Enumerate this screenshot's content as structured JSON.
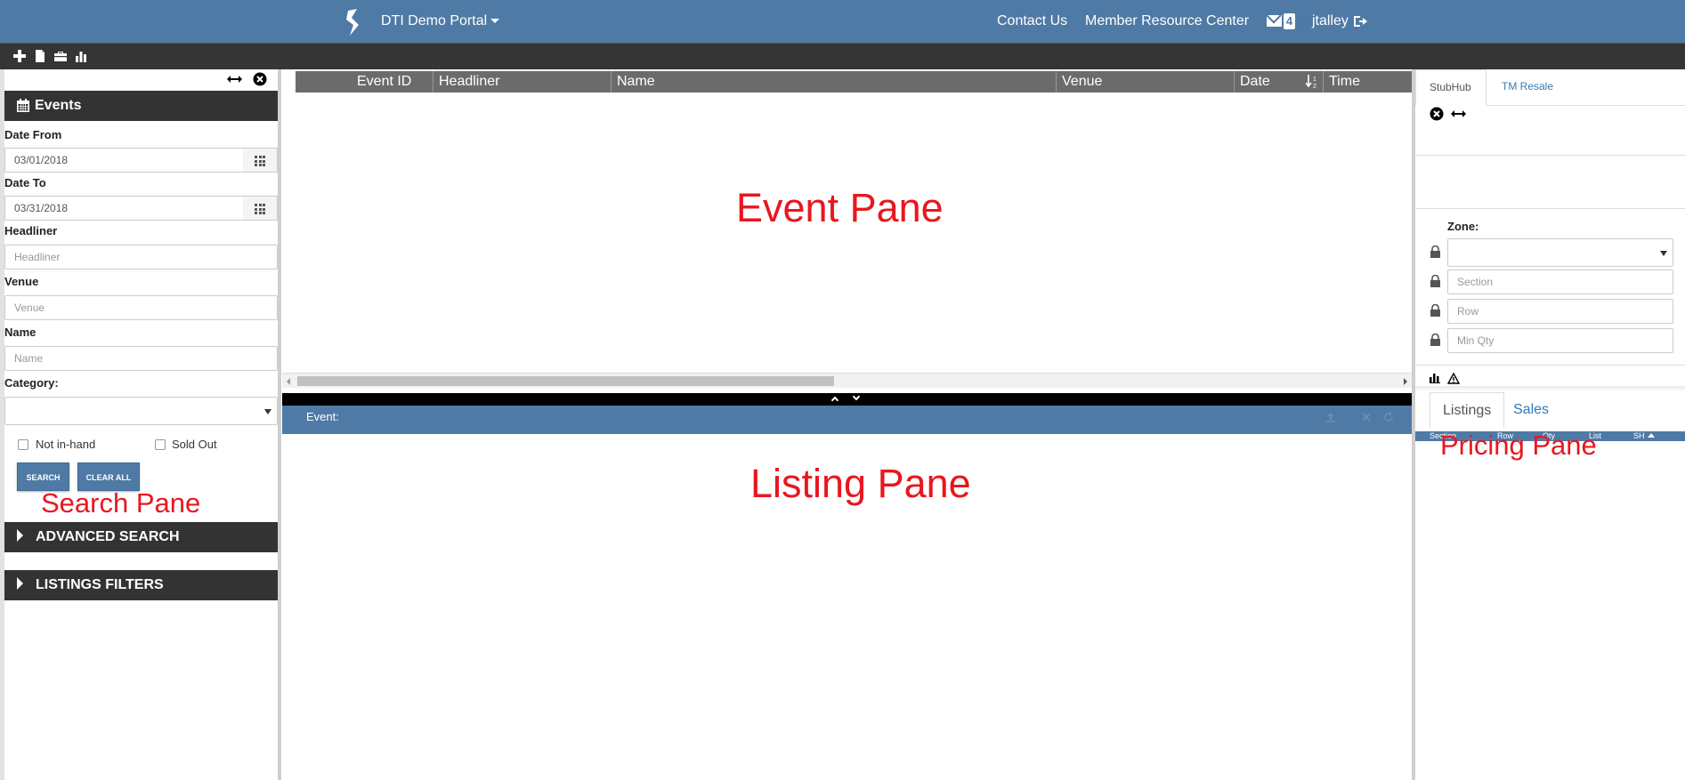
{
  "nav": {
    "brand": "DTI Demo Portal",
    "contact": "Contact Us",
    "member_center": "Member Resource Center",
    "mail_count": "4",
    "user": "jtalley",
    "bg_color": "#4f7aa5"
  },
  "toolbar": {
    "icons": [
      "plus-icon",
      "file-icon",
      "briefcase-icon",
      "bar-chart-icon"
    ]
  },
  "search_pane": {
    "section_title": "Events",
    "date_from_label": "Date From",
    "date_from_value": "03/01/2018",
    "date_to_label": "Date To",
    "date_to_value": "03/31/2018",
    "headliner_label": "Headliner",
    "headliner_placeholder": "Headliner",
    "venue_label": "Venue",
    "venue_placeholder": "Venue",
    "name_label": "Name",
    "name_placeholder": "Name",
    "category_label": "Category:",
    "category_value": "",
    "not_in_hand": "Not in-hand",
    "sold_out": "Sold Out",
    "search_btn": "SEARCH",
    "clear_btn": "CLEAR ALL",
    "advanced": "ADVANCED SEARCH",
    "listings_filters": "LISTINGS FILTERS"
  },
  "event_pane": {
    "columns": [
      "Event ID",
      "Headliner",
      "Name",
      "Venue",
      "Date",
      "Time"
    ]
  },
  "listing_pane": {
    "event_label": "Event:"
  },
  "pricing_pane": {
    "tabs": [
      "StubHub",
      "TM Resale"
    ],
    "zone_label": "Zone:",
    "zone_value": "",
    "section_placeholder": "Section",
    "row_placeholder": "Row",
    "min_qty_placeholder": "Min Qty",
    "bottom_tabs": [
      "Listings",
      "Sales"
    ],
    "mini_columns": [
      "Section",
      "Row",
      "Qty",
      "List",
      "SH"
    ]
  },
  "annotations": {
    "search": "Search Pane",
    "event": "Event Pane",
    "listing": "Listing Pane",
    "pricing": "Pricing Pane",
    "color": "#e8171f"
  }
}
